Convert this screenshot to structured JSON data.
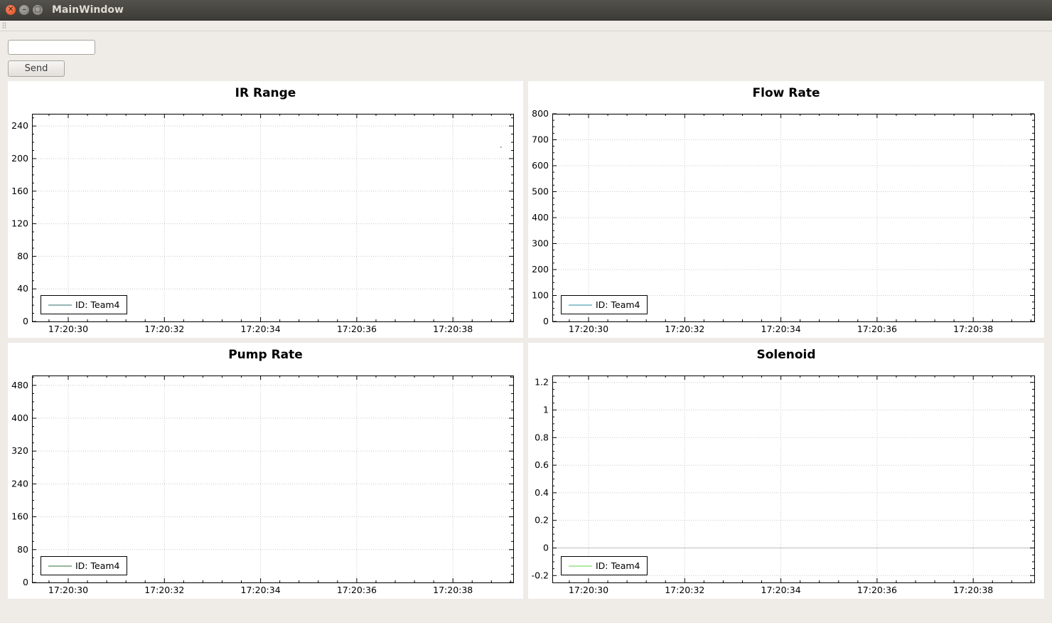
{
  "window": {
    "title": "MainWindow"
  },
  "controls": {
    "input_value": "",
    "send_label": "Send"
  },
  "chart_data": [
    {
      "type": "line",
      "title": "IR Range",
      "x_ticks": [
        "17:20:30",
        "17:20:32",
        "17:20:34",
        "17:20:36",
        "17:20:38"
      ],
      "y_ticks": [
        "0",
        "40",
        "80",
        "120",
        "160",
        "200",
        "240"
      ],
      "ylim": [
        0,
        255
      ],
      "grid": true,
      "legend_position": "bottom-left",
      "series": [
        {
          "name": "ID: Team4",
          "color": "#2f6b6b",
          "points": [
            {
              "x": "17:20:39",
              "y": 214
            }
          ]
        }
      ]
    },
    {
      "type": "line",
      "title": "Flow Rate",
      "x_ticks": [
        "17:20:30",
        "17:20:32",
        "17:20:34",
        "17:20:36",
        "17:20:38"
      ],
      "y_ticks": [
        "0",
        "100",
        "200",
        "300",
        "400",
        "500",
        "600",
        "700",
        "800"
      ],
      "ylim": [
        0,
        800
      ],
      "grid": true,
      "legend_position": "bottom-left",
      "series": [
        {
          "name": "ID: Team4",
          "color": "#2a8aa0",
          "points": []
        }
      ]
    },
    {
      "type": "line",
      "title": "Pump Rate",
      "x_ticks": [
        "17:20:30",
        "17:20:32",
        "17:20:34",
        "17:20:36",
        "17:20:38"
      ],
      "y_ticks": [
        "0",
        "80",
        "160",
        "240",
        "320",
        "400",
        "480"
      ],
      "ylim": [
        0,
        504
      ],
      "grid": true,
      "legend_position": "bottom-left",
      "series": [
        {
          "name": "ID: Team4",
          "color": "#2e6e3a",
          "points": []
        }
      ]
    },
    {
      "type": "line",
      "title": "Solenoid",
      "x_ticks": [
        "17:20:30",
        "17:20:32",
        "17:20:34",
        "17:20:36",
        "17:20:38"
      ],
      "y_ticks": [
        "-0.2",
        "0",
        "0.2",
        "0.4",
        "0.6",
        "0.8",
        "1",
        "1.2"
      ],
      "ylim": [
        -0.25,
        1.25
      ],
      "grid": true,
      "legend_position": "bottom-left",
      "series": [
        {
          "name": "ID: Team4",
          "color": "#5fd34a",
          "points": []
        }
      ]
    }
  ]
}
